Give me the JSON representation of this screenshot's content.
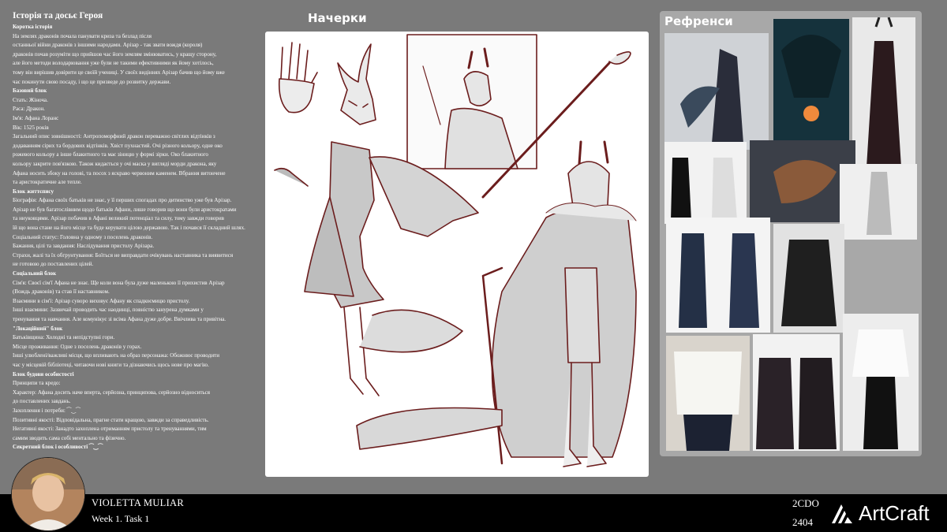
{
  "story": {
    "title": "Історія та досьє Героя",
    "lines": [
      {
        "t": "Коротка історія",
        "h": true
      },
      {
        "t": "На землях драконів почала панувати криза та безлад після"
      },
      {
        "t": "останньої війни драконів з іншими народами. Арізар - так звати вождя (короля)"
      },
      {
        "t": "драконів почав розуміти що прийшов час його землям змінюватись, у кращу сторону,"
      },
      {
        "t": "але його методи володарювання уже були не такими ефективними як йому хотілось,"
      },
      {
        "t": "тому він вирішив довірити це своїй учениці. У своїх видіннях Арізар бачив що йому вже"
      },
      {
        "t": " час покинути свою посаду, і що це призведе до розвитку держави."
      },
      {
        "t": "Базовий блок",
        "h": true
      },
      {
        "t": "Стать: Жіноча."
      },
      {
        "t": "Раса: Дракон."
      },
      {
        "t": "Ім'я: Афана Лоранс"
      },
      {
        "t": "Вік: 1525 років"
      },
      {
        "t": "Загальний опис зовнішності: Антропоморфний дракон переважно світлих відтінків з"
      },
      {
        "t": "додаванням сірих та бордових відтінків. Хвіст пухнастий. Очі різного кольору, одне око"
      },
      {
        "t": " рожевого кольору а інше блакитного та має зіницю у формі зірки. Око блакитного"
      },
      {
        "t": "кольору закрите пов'язкою. Також кидається у очі маска у вигляді морди дракона, яку"
      },
      {
        "t": "Афана носить збоку на голові, та посох з яскраво червоним каменем. Вбрання витончене"
      },
      {
        "t": " та аристократичне але тепле."
      },
      {
        "t": "Блок життєпису",
        "h": true
      },
      {
        "t": "Біографія: Афана своїх батьків не знає, у її перших спогадах про дитинство уже був Арізар."
      },
      {
        "t": "Арізар не був багатослівним щодо батьків Афани, лише говорив що вони були аристократами"
      },
      {
        "t": "та ниуковцями. Арізар побачив в Афані великий потенціал та силу, тому завжди говорив"
      },
      {
        "t": "їй що вона стане на його місце та буде керувати цілою державою. Так і почався її складний шлях."
      },
      {
        "t": "Соціальний статус: Головна у одному з поселень драконів."
      },
      {
        "t": "Бажання, цілі та завдання: Наслідування пристолу Арізара."
      },
      {
        "t": "Страхи, жалі та їх обгрунтування: Боїться не виправдати очікувань наставника та виявитися"
      },
      {
        "t": "не готовою до поставлених цілей."
      },
      {
        "t": "Соціальний блок",
        "h": true
      },
      {
        "t": "Сім'я: Своєї сім'ї Афана не знає. Ще коли вона була дуже маленькою її прихистив Арізар"
      },
      {
        "t": "(Вождь драконів) та став її наставником."
      },
      {
        "t": "Взаємини в сім'ї: Арізар суворо виховує Афану як спадкоємицю пристолу."
      },
      {
        "t": "Інші взаємини: Зазвичай проводить час наодинці, повністю занурена думками у"
      },
      {
        "t": "тренування та навчання. Але комунікує зі всіма Афана дуже добре. Ввічлива та привітна."
      },
      {
        "t": "\"Локаційний\" блок",
        "h": true
      },
      {
        "t": "Батьківщина: Холодні та непідступні гори."
      },
      {
        "t": "Місце проживання: Одне з поселень драконів у горах."
      },
      {
        "t": "Інші улюблені/важливі місця, що впливають на образ персонажа: Обожнює проводити"
      },
      {
        "t": "час у місцевій бібліотеці, читаючи нові книги та дізнаючись щось нове про магію."
      },
      {
        "t": "Блок будови особистості",
        "h": true
      },
      {
        "t": "Принципи та кредо:"
      },
      {
        "t": "Характер: Афана досить наче вперта, серйозна, принципова, серйозно відноситься"
      },
      {
        "t": "до поставлених завдань."
      },
      {
        "t": "Захоплення і потреби: ⁀‿⁀"
      },
      {
        "t": "Позитивні якості: Відповідальна, прагне стати кращою, завжди за справедливість."
      },
      {
        "t": "Негативні якості: Занадто захоплена отриманням пристолу та тренуваннями, тим"
      },
      {
        "t": "самим зводить сама собі ментально та фізично."
      },
      {
        "t": "Секретний блок і особливості ⁀‿⁀",
        "h": true
      }
    ]
  },
  "sketches": {
    "title": "Начерки"
  },
  "references": {
    "title": "Рефренси"
  },
  "footer": {
    "name": "VIOLETTA MULIAR",
    "task": "Week 1. Task 1",
    "group": "2CDO",
    "year": "2404",
    "brand": "ArtCraft"
  },
  "colors": {
    "background": "#7a7a7a",
    "sketch_line": "#6b1d1d",
    "board": "#ffffff",
    "ref_panel": "#a8a8a8",
    "footer": "#000000"
  }
}
